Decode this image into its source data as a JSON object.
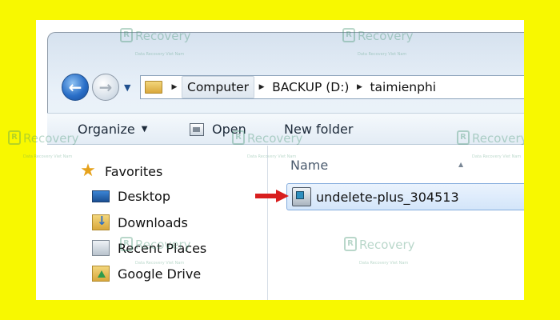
{
  "breadcrumb": {
    "segments": [
      "Computer",
      "BACKUP (D:)",
      "taimienphi"
    ]
  },
  "toolbar": {
    "organize_label": "Organize",
    "open_label": "Open",
    "new_folder_label": "New folder"
  },
  "nav_pane": {
    "items": [
      {
        "label": "Favorites",
        "icon": "star-icon"
      },
      {
        "label": "Desktop",
        "icon": "desktop-icon"
      },
      {
        "label": "Downloads",
        "icon": "downloads-folder-icon"
      },
      {
        "label": "Recent Places",
        "icon": "recent-places-icon"
      },
      {
        "label": "Google Drive",
        "icon": "google-drive-folder-icon"
      }
    ]
  },
  "file_list": {
    "column_header": "Name",
    "files": [
      {
        "name": "undelete-plus_304513",
        "icon": "installer-icon",
        "selected": true
      }
    ]
  },
  "watermark": {
    "brand": "Recovery",
    "tagline": "Data Recovery Viet Nam"
  },
  "colors": {
    "border_yellow": "#f8f800",
    "selection_fill": "#d3e5fa",
    "selection_border": "#84acdd",
    "arrow_red": "#d81e1e"
  }
}
